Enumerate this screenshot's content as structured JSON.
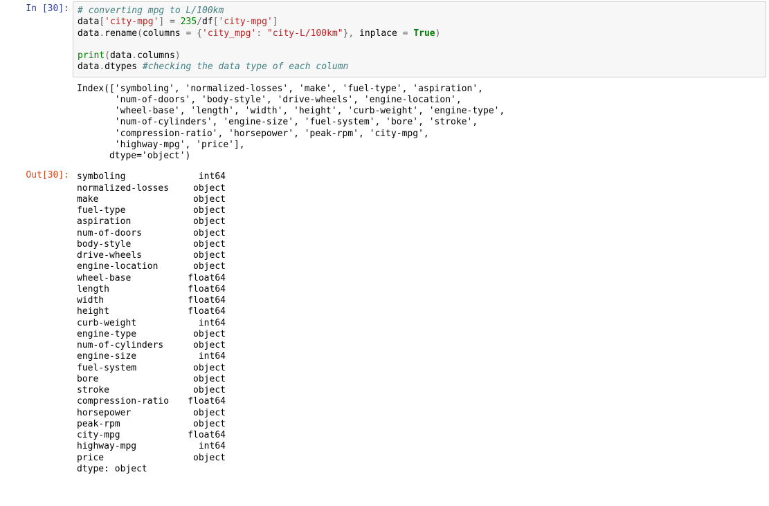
{
  "cell": {
    "in_prompt": "In [30]:",
    "out_prompt": "Out[30]:",
    "code": {
      "c01_comment": "# converting mpg to L/100km",
      "c02_data": "data",
      "c02_lbr": "[",
      "c02_key": "'city-mpg'",
      "c02_rbr": "]",
      "c02_eq": " = ",
      "c02_num": "235",
      "c02_div": "/",
      "c02_df": "df",
      "c02_lbr2": "[",
      "c02_key2": "'city-mpg'",
      "c02_rbr2": "]",
      "c03_data": "data",
      "c03_dot": ".",
      "c03_rename": "rename",
      "c03_lp": "(",
      "c03_cols": "columns",
      "c03_eq": " = ",
      "c03_lcb": "{",
      "c03_k1": "'city_mpg'",
      "c03_col": ": ",
      "c03_k2": "\"city-L/100km\"",
      "c03_rcb": "}",
      "c03_com": ", ",
      "c03_inp": "inplace",
      "c03_eq2": " = ",
      "c03_true": "True",
      "c03_rp": ")",
      "c05_print": "print",
      "c05_lp": "(",
      "c05_data": "data",
      "c05_dot": ".",
      "c05_cols": "columns",
      "c05_rp": ")",
      "c06_data": "data",
      "c06_dot": ".",
      "c06_dtypes": "dtypes",
      "c06_sp": " ",
      "c06_comment": "#checking the data type of each column"
    },
    "stdout": {
      "l1": "Index(['symboling', 'normalized-losses', 'make', 'fuel-type', 'aspiration',",
      "l2": "       'num-of-doors', 'body-style', 'drive-wheels', 'engine-location',",
      "l3": "       'wheel-base', 'length', 'width', 'height', 'curb-weight', 'engine-type',",
      "l4": "       'num-of-cylinders', 'engine-size', 'fuel-system', 'bore', 'stroke',",
      "l5": "       'compression-ratio', 'horsepower', 'peak-rpm', 'city-mpg',",
      "l6": "       'highway-mpg', 'price'],",
      "l7": "      dtype='object')"
    },
    "dtypes": [
      {
        "name": "symboling",
        "type": "int64"
      },
      {
        "name": "normalized-losses",
        "type": "object"
      },
      {
        "name": "make",
        "type": "object"
      },
      {
        "name": "fuel-type",
        "type": "object"
      },
      {
        "name": "aspiration",
        "type": "object"
      },
      {
        "name": "num-of-doors",
        "type": "object"
      },
      {
        "name": "body-style",
        "type": "object"
      },
      {
        "name": "drive-wheels",
        "type": "object"
      },
      {
        "name": "engine-location",
        "type": "object"
      },
      {
        "name": "wheel-base",
        "type": "float64"
      },
      {
        "name": "length",
        "type": "float64"
      },
      {
        "name": "width",
        "type": "float64"
      },
      {
        "name": "height",
        "type": "float64"
      },
      {
        "name": "curb-weight",
        "type": "int64"
      },
      {
        "name": "engine-type",
        "type": "object"
      },
      {
        "name": "num-of-cylinders",
        "type": "object"
      },
      {
        "name": "engine-size",
        "type": "int64"
      },
      {
        "name": "fuel-system",
        "type": "object"
      },
      {
        "name": "bore",
        "type": "object"
      },
      {
        "name": "stroke",
        "type": "object"
      },
      {
        "name": "compression-ratio",
        "type": "float64"
      },
      {
        "name": "horsepower",
        "type": "object"
      },
      {
        "name": "peak-rpm",
        "type": "object"
      },
      {
        "name": "city-mpg",
        "type": "float64"
      },
      {
        "name": "highway-mpg",
        "type": "int64"
      },
      {
        "name": "price",
        "type": "object"
      }
    ],
    "dtypes_footer": "dtype: object"
  }
}
